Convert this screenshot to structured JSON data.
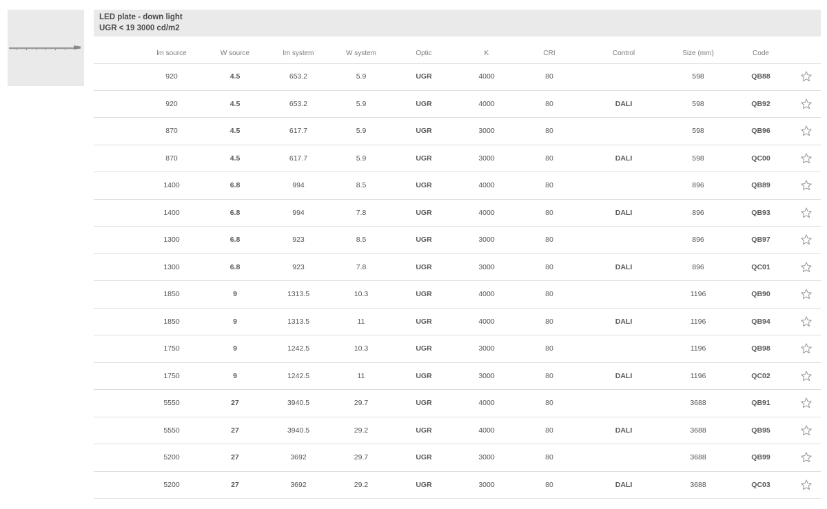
{
  "product": {
    "title": "LED plate - down light",
    "subtitle": "UGR < 19 3000 cd/m2",
    "image_icon": "led-plate-image"
  },
  "columns": [
    "lm source",
    "W source",
    "lm system",
    "W system",
    "Optic",
    "K",
    "CRI",
    "Control",
    "Size (mm)",
    "Code"
  ],
  "rows": [
    {
      "lm_source": "920",
      "w_source": "4.5",
      "lm_system": "653.2",
      "w_system": "5.9",
      "optic": "UGR",
      "k": "4000",
      "cri": "80",
      "control": "",
      "size": "598",
      "code": "QB88"
    },
    {
      "lm_source": "920",
      "w_source": "4.5",
      "lm_system": "653.2",
      "w_system": "5.9",
      "optic": "UGR",
      "k": "4000",
      "cri": "80",
      "control": "DALI",
      "size": "598",
      "code": "QB92"
    },
    {
      "lm_source": "870",
      "w_source": "4.5",
      "lm_system": "617.7",
      "w_system": "5.9",
      "optic": "UGR",
      "k": "3000",
      "cri": "80",
      "control": "",
      "size": "598",
      "code": "QB96"
    },
    {
      "lm_source": "870",
      "w_source": "4.5",
      "lm_system": "617.7",
      "w_system": "5.9",
      "optic": "UGR",
      "k": "3000",
      "cri": "80",
      "control": "DALI",
      "size": "598",
      "code": "QC00"
    },
    {
      "lm_source": "1400",
      "w_source": "6.8",
      "lm_system": "994",
      "w_system": "8.5",
      "optic": "UGR",
      "k": "4000",
      "cri": "80",
      "control": "",
      "size": "896",
      "code": "QB89"
    },
    {
      "lm_source": "1400",
      "w_source": "6.8",
      "lm_system": "994",
      "w_system": "7.8",
      "optic": "UGR",
      "k": "4000",
      "cri": "80",
      "control": "DALI",
      "size": "896",
      "code": "QB93"
    },
    {
      "lm_source": "1300",
      "w_source": "6.8",
      "lm_system": "923",
      "w_system": "8.5",
      "optic": "UGR",
      "k": "3000",
      "cri": "80",
      "control": "",
      "size": "896",
      "code": "QB97"
    },
    {
      "lm_source": "1300",
      "w_source": "6.8",
      "lm_system": "923",
      "w_system": "7.8",
      "optic": "UGR",
      "k": "3000",
      "cri": "80",
      "control": "DALI",
      "size": "896",
      "code": "QC01"
    },
    {
      "lm_source": "1850",
      "w_source": "9",
      "lm_system": "1313.5",
      "w_system": "10.3",
      "optic": "UGR",
      "k": "4000",
      "cri": "80",
      "control": "",
      "size": "1196",
      "code": "QB90"
    },
    {
      "lm_source": "1850",
      "w_source": "9",
      "lm_system": "1313.5",
      "w_system": "11",
      "optic": "UGR",
      "k": "4000",
      "cri": "80",
      "control": "DALI",
      "size": "1196",
      "code": "QB94"
    },
    {
      "lm_source": "1750",
      "w_source": "9",
      "lm_system": "1242.5",
      "w_system": "10.3",
      "optic": "UGR",
      "k": "3000",
      "cri": "80",
      "control": "",
      "size": "1196",
      "code": "QB98"
    },
    {
      "lm_source": "1750",
      "w_source": "9",
      "lm_system": "1242.5",
      "w_system": "11",
      "optic": "UGR",
      "k": "3000",
      "cri": "80",
      "control": "DALI",
      "size": "1196",
      "code": "QC02"
    },
    {
      "lm_source": "5550",
      "w_source": "27",
      "lm_system": "3940.5",
      "w_system": "29.7",
      "optic": "UGR",
      "k": "4000",
      "cri": "80",
      "control": "",
      "size": "3688",
      "code": "QB91"
    },
    {
      "lm_source": "5550",
      "w_source": "27",
      "lm_system": "3940.5",
      "w_system": "29.2",
      "optic": "UGR",
      "k": "4000",
      "cri": "80",
      "control": "DALI",
      "size": "3688",
      "code": "QB95"
    },
    {
      "lm_source": "5200",
      "w_source": "27",
      "lm_system": "3692",
      "w_system": "29.7",
      "optic": "UGR",
      "k": "3000",
      "cri": "80",
      "control": "",
      "size": "3688",
      "code": "QB99"
    },
    {
      "lm_source": "5200",
      "w_source": "27",
      "lm_system": "3692",
      "w_system": "29.2",
      "optic": "UGR",
      "k": "3000",
      "cri": "80",
      "control": "DALI",
      "size": "3688",
      "code": "QC03"
    }
  ],
  "icons": {
    "favorite": "star-outline-icon"
  },
  "colors": {
    "band": "#eaeaea",
    "divider": "#dddddd",
    "text": "#555555"
  }
}
